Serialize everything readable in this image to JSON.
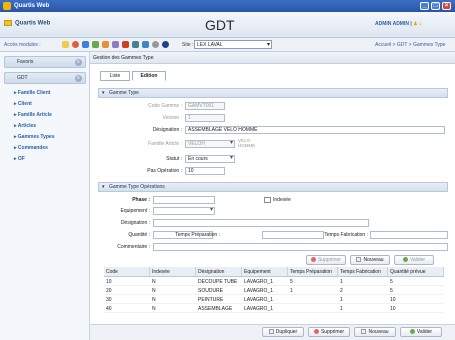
{
  "window": {
    "title": "Quartis Web",
    "min": "_",
    "max": "□",
    "close": "×"
  },
  "header": {
    "app_name": "Quartis Web",
    "page_title": "GDT",
    "user": "ADMIN ADMIN | "
  },
  "toolbar": {
    "access_label": "Accès modules :",
    "site_label": "Site :",
    "site_value": "LEX LAVAL",
    "breadcrumb": "Accueil > GDT > Gammes Type"
  },
  "sidebar": {
    "favoris": "Favoris",
    "gdt": "GDT",
    "items": [
      "Famille Client",
      "Client",
      "Famille Article",
      "Articles",
      "Gammes Types",
      "Commandes",
      "OF"
    ]
  },
  "page": {
    "heading": "Gestion des Gammes Type",
    "tabs": [
      "Liste",
      "Edition"
    ]
  },
  "gamme_type": {
    "section": "Gamme Type",
    "code_label": "Code Gamme :",
    "code_value": "GAMVT001",
    "version_label": "Version :",
    "version_value": "1",
    "designation_label": "Désignation :",
    "designation_value": "ASSEMBLAGE VELO HOMME",
    "famille_label": "Famille Article :",
    "famille_value": "VELOH",
    "famille_text": "VELO HOMME",
    "statut_label": "Statut :",
    "statut_value": "En cours",
    "pas_label": "Pas Opération :",
    "pas_value": "10"
  },
  "operations": {
    "section": "Gamme Type Opérations",
    "phase_label": "Phase :",
    "indexe_label": "Indexée",
    "equipement_label": "Equipement :",
    "designation_label": "Désignation :",
    "quantite_label": "Quantité :",
    "temps_prep_label": "Temps Préparation :",
    "temps_fab_label": "Temps Fabrication :",
    "commentaire_label": "Commentaire :",
    "buttons": [
      "Supprimer",
      "Nouveau",
      "Valider"
    ]
  },
  "table": {
    "columns": [
      "Code",
      "Indexée",
      "Désignation",
      "Equipement",
      "Temps Préparation",
      "Temps Fabrication",
      "Quantité prévue"
    ],
    "rows": [
      [
        "10",
        "N",
        "DECOUPE TUBE",
        "LAVAGRO_1",
        "5",
        "1",
        "5"
      ],
      [
        "20",
        "N",
        "SOUDURE",
        "LAVAGRO_1",
        "1",
        "2",
        "5"
      ],
      [
        "30",
        "N",
        "PEINTURE",
        "LAVAGRO_1",
        "",
        "1",
        "10"
      ],
      [
        "40",
        "N",
        "ASSEMBLAGE",
        "LAVAGRO_1",
        "",
        "1",
        "10"
      ]
    ]
  },
  "footer": {
    "buttons": [
      "Dupliquer",
      "Supprimer",
      "Nouveau",
      "Valider"
    ]
  }
}
